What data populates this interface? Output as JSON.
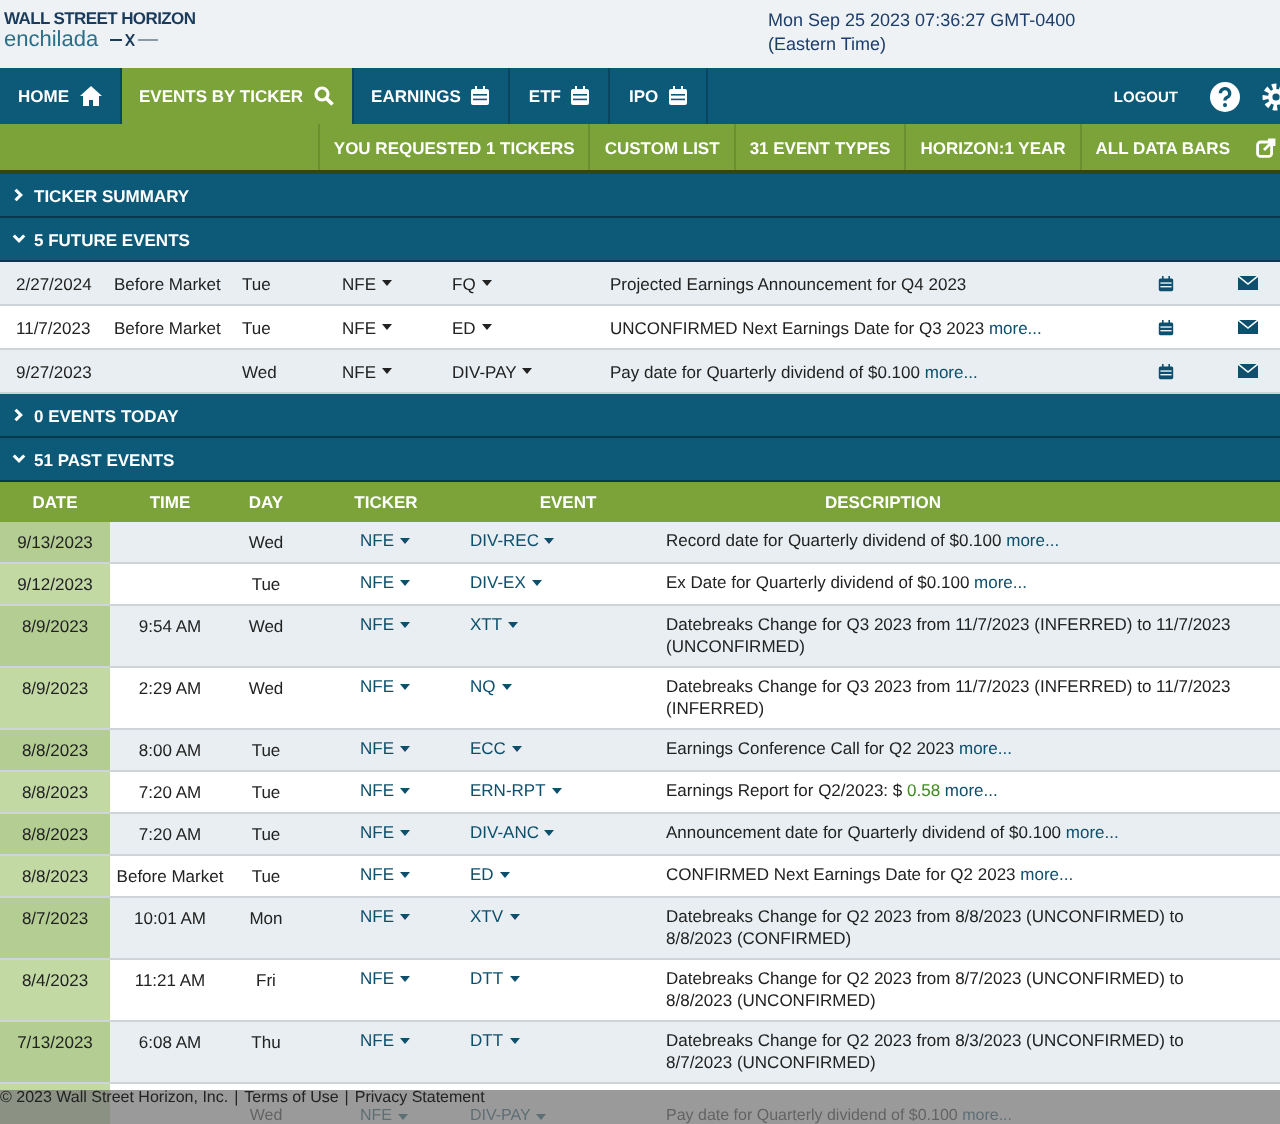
{
  "header": {
    "logo": {
      "brand": "WALL STREET HORIZON",
      "product": "enchilada"
    },
    "clock": "Mon Sep 25 2023 07:36:27 GMT-0400",
    "timezone": "(Eastern Time)"
  },
  "nav": {
    "items": [
      {
        "label": "HOME",
        "selected": false
      },
      {
        "label": "EVENTS BY TICKER",
        "selected": true
      },
      {
        "label": "EARNINGS",
        "selected": false
      },
      {
        "label": "ETF",
        "selected": false
      },
      {
        "label": "IPO",
        "selected": false
      }
    ],
    "logout": "LOGOUT"
  },
  "filter_bar": [
    "YOU REQUESTED 1 TICKERS",
    "CUSTOM LIST",
    "31 EVENT TYPES",
    "HORIZON:1 YEAR",
    "ALL DATA BARS"
  ],
  "sections": [
    {
      "title": "TICKER SUMMARY",
      "expanded": false
    },
    {
      "title": "5 FUTURE EVENTS",
      "expanded": true,
      "kind": "future",
      "rows": [
        {
          "date": "2/27/2024",
          "time": "Before Market",
          "day": "Tue",
          "ticker": "NFE",
          "event": "FQ",
          "description": {
            "text": "Projected Earnings Announcement for Q4 2023"
          }
        },
        {
          "date": "11/7/2023",
          "time": "Before Market",
          "day": "Tue",
          "ticker": "NFE",
          "event": "ED",
          "description": {
            "text": "UNCONFIRMED Next Earnings Date for Q3 2023 ",
            "more": "more..."
          }
        },
        {
          "date": "9/27/2023",
          "day": "Wed",
          "ticker": "NFE",
          "event": "DIV-PAY",
          "description": {
            "text": "Pay date for Quarterly dividend of $0.100 ",
            "more": "more..."
          }
        }
      ]
    },
    {
      "title": "0 EVENTS TODAY",
      "expanded": false
    },
    {
      "title": "51 PAST EVENTS",
      "expanded": true,
      "kind": "past",
      "columns": [
        "DATE",
        "TIME",
        "DAY",
        "TICKER",
        "EVENT",
        "DESCRIPTION"
      ],
      "rows": [
        {
          "date": "9/13/2023",
          "day": "Wed",
          "ticker": "NFE",
          "event": "DIV-REC",
          "description": {
            "text": "Record date for Quarterly dividend of $0.100 ",
            "more": "more..."
          }
        },
        {
          "date": "9/12/2023",
          "day": "Tue",
          "ticker": "NFE",
          "event": "DIV-EX",
          "description": {
            "text": "Ex Date for Quarterly dividend of $0.100 ",
            "more": "more..."
          }
        },
        {
          "date": "8/9/2023",
          "time": "9:54 AM",
          "day": "Wed",
          "ticker": "NFE",
          "event": "XTT",
          "description": {
            "text": "Datebreaks Change for Q3 2023 from 11/7/2023 (INFERRED) to 11/7/2023 (UNCONFIRMED)"
          }
        },
        {
          "date": "8/9/2023",
          "time": "2:29 AM",
          "day": "Wed",
          "ticker": "NFE",
          "event": "NQ",
          "description": {
            "text": "Datebreaks Change for Q3 2023 from 11/7/2023 (INFERRED) to 11/7/2023 (INFERRED)"
          }
        },
        {
          "date": "8/8/2023",
          "time": "8:00 AM",
          "day": "Tue",
          "ticker": "NFE",
          "event": "ECC",
          "description": {
            "text": "Earnings Conference Call for Q2 2023 ",
            "more": "more..."
          }
        },
        {
          "date": "8/8/2023",
          "time": "7:20 AM",
          "day": "Tue",
          "ticker": "NFE",
          "event": "ERN-RPT",
          "description": {
            "text": "Earnings Report for Q2/2023: $ ",
            "value": "0.58",
            "more": "more..."
          }
        },
        {
          "date": "8/8/2023",
          "time": "7:20 AM",
          "day": "Tue",
          "ticker": "NFE",
          "event": "DIV-ANC",
          "description": {
            "text": "Announcement date for Quarterly dividend of $0.100 ",
            "more": "more..."
          }
        },
        {
          "date": "8/8/2023",
          "time": "Before Market",
          "day": "Tue",
          "ticker": "NFE",
          "event": "ED",
          "description": {
            "text": "CONFIRMED Next Earnings Date for Q2 2023 ",
            "more": "more..."
          }
        },
        {
          "date": "8/7/2023",
          "time": "10:01 AM",
          "day": "Mon",
          "ticker": "NFE",
          "event": "XTV",
          "description": {
            "text": "Datebreaks Change for Q2 2023 from 8/8/2023 (UNCONFIRMED) to 8/8/2023 (CONFIRMED)"
          }
        },
        {
          "date": "8/4/2023",
          "time": "11:21 AM",
          "day": "Fri",
          "ticker": "NFE",
          "event": "DTT",
          "description": {
            "text": "Datebreaks Change for Q2 2023 from 8/7/2023 (UNCONFIRMED) to 8/8/2023 (UNCONFIRMED)"
          }
        },
        {
          "date": "7/13/2023",
          "time": "6:08 AM",
          "day": "Thu",
          "ticker": "NFE",
          "event": "DTT",
          "description": {
            "text": "Datebreaks Change for Q2 2023 from 8/3/2023 (UNCONFIRMED) to 8/7/2023 (UNCONFIRMED)"
          }
        },
        {
          "day": "Wed",
          "ticker": "NFE",
          "event": "DIV-PAY",
          "description": {
            "text": "Pay date for Quarterly dividend of $0.100 ",
            "more": "more..."
          }
        }
      ]
    }
  ],
  "footer": {
    "copyright": "© 2023 Wall Street Horizon, Inc.",
    "separator": "|",
    "links": [
      "Terms of Use",
      "Privacy Statement"
    ]
  }
}
